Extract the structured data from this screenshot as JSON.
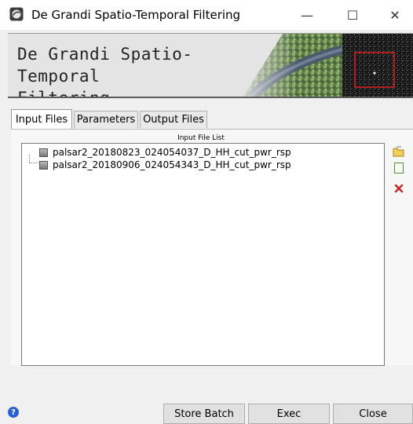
{
  "window": {
    "title": "De Grandi Spatio-Temporal Filtering",
    "controls": {
      "minimize": "—",
      "maximize": "☐",
      "close": "✕"
    }
  },
  "banner": {
    "title_line1": "De Grandi Spatio-Temporal",
    "title_line2": "Filtering"
  },
  "tabs": [
    {
      "label": "Input Files",
      "active": true
    },
    {
      "label": "Parameters",
      "active": false
    },
    {
      "label": "Output Files",
      "active": false
    }
  ],
  "input_files": {
    "list_label": "Input File List",
    "files": [
      "palsar2_20180823_024054037_D_HH_cut_pwr_rsp",
      "palsar2_20180906_024054343_D_HH_cut_pwr_rsp"
    ],
    "actions": {
      "open_icon": "folder-open-icon",
      "new_icon": "file-new-icon",
      "remove_icon": "remove-x-icon"
    }
  },
  "footer": {
    "help": "?",
    "store_batch": "Store Batch",
    "exec": "Exec",
    "close": "Close"
  },
  "colors": {
    "help_blue": "#2a5fd6",
    "remove_red": "#cc2222",
    "open_yellow": "#e8b830"
  }
}
